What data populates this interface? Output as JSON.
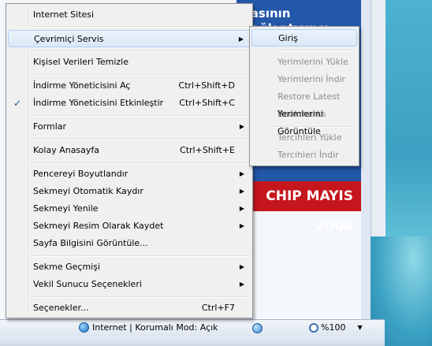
{
  "background": {
    "banner_text": "...",
    "magazine_label": "CHIP MAYIS 2008"
  },
  "main_menu": {
    "items": [
      {
        "label": "Internet Sitesi",
        "shortcut": ""
      },
      {
        "label": "Çevrimiçi Servis",
        "shortcut": ""
      },
      {
        "label": "Kişisel Verileri Temizle",
        "shortcut": ""
      },
      {
        "label": "İndirme Yöneticisini Aç",
        "shortcut": "Ctrl+Shift+D"
      },
      {
        "label": "İndirme Yöneticisini Etkinleştir",
        "shortcut": "Ctrl+Shift+C"
      },
      {
        "label": "Formlar",
        "shortcut": ""
      },
      {
        "label": "Kolay Anasayfa",
        "shortcut": "Ctrl+Shift+E"
      },
      {
        "label": "Pencereyi Boyutlandır",
        "shortcut": ""
      },
      {
        "label": "Sekmeyi Otomatik Kaydır",
        "shortcut": ""
      },
      {
        "label": "Sekmeyi Yenile",
        "shortcut": ""
      },
      {
        "label": "Sekmeyi Resim Olarak Kaydet",
        "shortcut": ""
      },
      {
        "label": "Sayfa Bilgisini Görüntüle...",
        "shortcut": ""
      },
      {
        "label": "Sekme Geçmişi",
        "shortcut": ""
      },
      {
        "label": "Vekil Sunucu Seçenekleri",
        "shortcut": ""
      },
      {
        "label": "Seçenekler...",
        "shortcut": "Ctrl+F7"
      }
    ]
  },
  "sub_menu": {
    "items": [
      {
        "label": "Giriş"
      },
      {
        "label": "Yerimlerini Yükle"
      },
      {
        "label": "Yerimlerini İndir"
      },
      {
        "label": "Restore Latest Bookmarks"
      },
      {
        "label": "Yerimlerini Görüntüle"
      },
      {
        "label": "Tercihleri Yükle"
      },
      {
        "label": "Tercihleri İndir"
      }
    ]
  },
  "statusbar": {
    "zone_text": "Internet | Korumalı Mod: Açık",
    "zoom": "%100"
  }
}
